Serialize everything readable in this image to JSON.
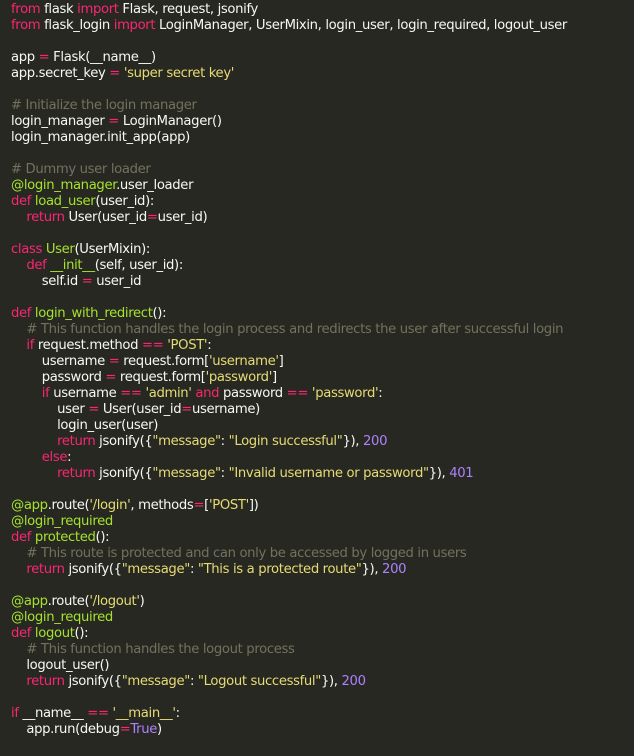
{
  "theme": {
    "background": "#272822",
    "colors": {
      "kw": "#f92672",
      "fn": "#a6e22e",
      "str": "#e6db74",
      "num": "#ae81ff",
      "com": "#75715e",
      "dec": "#a6e22e",
      "txt": "#f8f8f2"
    }
  },
  "code": {
    "language": "python",
    "lines": [
      [
        [
          "kw",
          "from"
        ],
        [
          "txt",
          " flask "
        ],
        [
          "kw",
          "import"
        ],
        [
          "txt",
          " Flask, request, jsonify"
        ]
      ],
      [
        [
          "kw",
          "from"
        ],
        [
          "txt",
          " flask_login "
        ],
        [
          "kw",
          "import"
        ],
        [
          "txt",
          " LoginManager, UserMixin, login_user, login_required, logout_user"
        ]
      ],
      [],
      [
        [
          "txt",
          "app "
        ],
        [
          "kw",
          "="
        ],
        [
          "txt",
          " Flask(__name__)"
        ]
      ],
      [
        [
          "txt",
          "app.secret_key "
        ],
        [
          "kw",
          "="
        ],
        [
          "txt",
          " "
        ],
        [
          "str",
          "'super secret key'"
        ]
      ],
      [],
      [
        [
          "com",
          "# Initialize the login manager"
        ]
      ],
      [
        [
          "txt",
          "login_manager "
        ],
        [
          "kw",
          "="
        ],
        [
          "txt",
          " LoginManager()"
        ]
      ],
      [
        [
          "txt",
          "login_manager.init_app(app)"
        ]
      ],
      [],
      [
        [
          "com",
          "# Dummy user loader"
        ]
      ],
      [
        [
          "dec",
          "@login_manager"
        ],
        [
          "txt",
          ".user_loader"
        ]
      ],
      [
        [
          "kw",
          "def"
        ],
        [
          "txt",
          " "
        ],
        [
          "fn",
          "load_user"
        ],
        [
          "txt",
          "(user_id):"
        ]
      ],
      [
        [
          "txt",
          "    "
        ],
        [
          "kw",
          "return"
        ],
        [
          "txt",
          " User(user_id"
        ],
        [
          "kw",
          "="
        ],
        [
          "txt",
          "user_id)"
        ]
      ],
      [],
      [
        [
          "kw",
          "class"
        ],
        [
          "txt",
          " "
        ],
        [
          "fn",
          "User"
        ],
        [
          "txt",
          "(UserMixin):"
        ]
      ],
      [
        [
          "txt",
          "    "
        ],
        [
          "kw",
          "def"
        ],
        [
          "txt",
          " "
        ],
        [
          "fn",
          "__init__"
        ],
        [
          "txt",
          "(self, user_id):"
        ]
      ],
      [
        [
          "txt",
          "        self.id "
        ],
        [
          "kw",
          "="
        ],
        [
          "txt",
          " user_id"
        ]
      ],
      [],
      [
        [
          "kw",
          "def"
        ],
        [
          "txt",
          " "
        ],
        [
          "fn",
          "login_with_redirect"
        ],
        [
          "txt",
          "():"
        ]
      ],
      [
        [
          "txt",
          "    "
        ],
        [
          "com",
          "# This function handles the login process and redirects the user after successful login"
        ]
      ],
      [
        [
          "txt",
          "    "
        ],
        [
          "kw",
          "if"
        ],
        [
          "txt",
          " request.method "
        ],
        [
          "kw",
          "=="
        ],
        [
          "txt",
          " "
        ],
        [
          "str",
          "'POST'"
        ],
        [
          "txt",
          ":"
        ]
      ],
      [
        [
          "txt",
          "        username "
        ],
        [
          "kw",
          "="
        ],
        [
          "txt",
          " request.form["
        ],
        [
          "str",
          "'username'"
        ],
        [
          "txt",
          "]"
        ]
      ],
      [
        [
          "txt",
          "        password "
        ],
        [
          "kw",
          "="
        ],
        [
          "txt",
          " request.form["
        ],
        [
          "str",
          "'password'"
        ],
        [
          "txt",
          "]"
        ]
      ],
      [
        [
          "txt",
          "        "
        ],
        [
          "kw",
          "if"
        ],
        [
          "txt",
          " username "
        ],
        [
          "kw",
          "=="
        ],
        [
          "txt",
          " "
        ],
        [
          "str",
          "'admin'"
        ],
        [
          "txt",
          " "
        ],
        [
          "kw",
          "and"
        ],
        [
          "txt",
          " password "
        ],
        [
          "kw",
          "=="
        ],
        [
          "txt",
          " "
        ],
        [
          "str",
          "'password'"
        ],
        [
          "txt",
          ":"
        ]
      ],
      [
        [
          "txt",
          "            user "
        ],
        [
          "kw",
          "="
        ],
        [
          "txt",
          " User(user_id"
        ],
        [
          "kw",
          "="
        ],
        [
          "txt",
          "username)"
        ]
      ],
      [
        [
          "txt",
          "            login_user(user)"
        ]
      ],
      [
        [
          "txt",
          "            "
        ],
        [
          "kw",
          "return"
        ],
        [
          "txt",
          " jsonify({"
        ],
        [
          "str",
          "\"message\""
        ],
        [
          "txt",
          ": "
        ],
        [
          "str",
          "\"Login successful\""
        ],
        [
          "txt",
          "}), "
        ],
        [
          "num",
          "200"
        ]
      ],
      [
        [
          "txt",
          "        "
        ],
        [
          "kw",
          "else"
        ],
        [
          "txt",
          ":"
        ]
      ],
      [
        [
          "txt",
          "            "
        ],
        [
          "kw",
          "return"
        ],
        [
          "txt",
          " jsonify({"
        ],
        [
          "str",
          "\"message\""
        ],
        [
          "txt",
          ": "
        ],
        [
          "str",
          "\"Invalid username or password\""
        ],
        [
          "txt",
          "}), "
        ],
        [
          "num",
          "401"
        ]
      ],
      [],
      [
        [
          "dec",
          "@app"
        ],
        [
          "txt",
          ".route("
        ],
        [
          "str",
          "'/login'"
        ],
        [
          "txt",
          ", methods"
        ],
        [
          "kw",
          "="
        ],
        [
          "txt",
          "["
        ],
        [
          "str",
          "'POST'"
        ],
        [
          "txt",
          "])"
        ]
      ],
      [
        [
          "dec",
          "@login_required"
        ]
      ],
      [
        [
          "kw",
          "def"
        ],
        [
          "txt",
          " "
        ],
        [
          "fn",
          "protected"
        ],
        [
          "txt",
          "():"
        ]
      ],
      [
        [
          "txt",
          "    "
        ],
        [
          "com",
          "# This route is protected and can only be accessed by logged in users"
        ]
      ],
      [
        [
          "txt",
          "    "
        ],
        [
          "kw",
          "return"
        ],
        [
          "txt",
          " jsonify({"
        ],
        [
          "str",
          "\"message\""
        ],
        [
          "txt",
          ": "
        ],
        [
          "str",
          "\"This is a protected route\""
        ],
        [
          "txt",
          "}), "
        ],
        [
          "num",
          "200"
        ]
      ],
      [],
      [
        [
          "dec",
          "@app"
        ],
        [
          "txt",
          ".route("
        ],
        [
          "str",
          "'/logout'"
        ],
        [
          "txt",
          ")"
        ]
      ],
      [
        [
          "dec",
          "@login_required"
        ]
      ],
      [
        [
          "kw",
          "def"
        ],
        [
          "txt",
          " "
        ],
        [
          "fn",
          "logout"
        ],
        [
          "txt",
          "():"
        ]
      ],
      [
        [
          "txt",
          "    "
        ],
        [
          "com",
          "# This function handles the logout process"
        ]
      ],
      [
        [
          "txt",
          "    logout_user()"
        ]
      ],
      [
        [
          "txt",
          "    "
        ],
        [
          "kw",
          "return"
        ],
        [
          "txt",
          " jsonify({"
        ],
        [
          "str",
          "\"message\""
        ],
        [
          "txt",
          ": "
        ],
        [
          "str",
          "\"Logout successful\""
        ],
        [
          "txt",
          "}), "
        ],
        [
          "num",
          "200"
        ]
      ],
      [],
      [
        [
          "kw",
          "if"
        ],
        [
          "txt",
          " __name__ "
        ],
        [
          "kw",
          "=="
        ],
        [
          "txt",
          " "
        ],
        [
          "str",
          "'__main__'"
        ],
        [
          "txt",
          ":"
        ]
      ],
      [
        [
          "txt",
          "    app.run(debug"
        ],
        [
          "kw",
          "="
        ],
        [
          "num",
          "True"
        ],
        [
          "txt",
          ")"
        ]
      ]
    ]
  }
}
